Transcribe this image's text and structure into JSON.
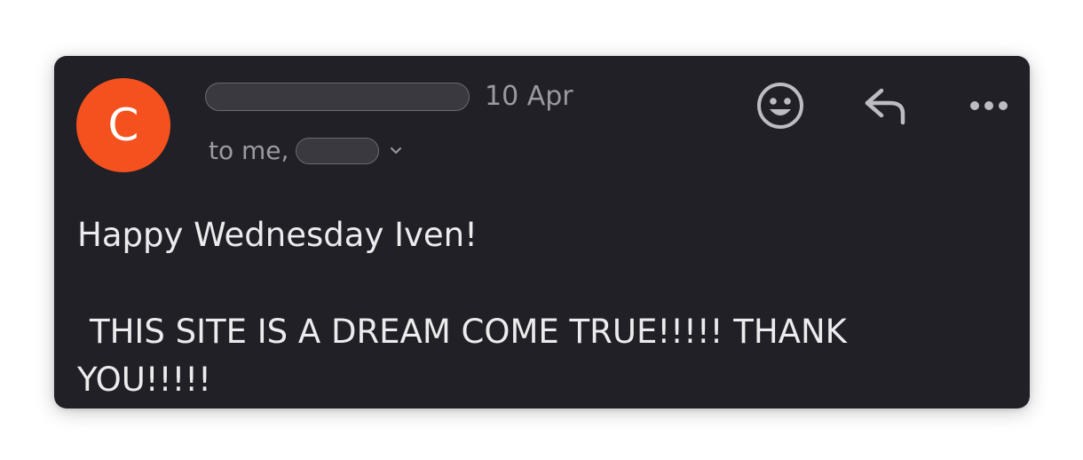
{
  "email": {
    "avatar_letter": "C",
    "avatar_color": "#f4511e",
    "date": "10 Apr",
    "recipients_prefix": "to me,",
    "body_greeting": "Happy Wednesday Iven!",
    "body_line1": "THIS SITE IS A DREAM COME TRUE!!!!! THANK",
    "body_line2": "YOU!!!!!"
  },
  "icons": {
    "emoji": "smiley-face-icon",
    "reply": "reply-arrow-icon",
    "more": "more-horizontal-icon",
    "expand": "chevron-down-icon"
  },
  "colors": {
    "background": "#212026",
    "text_primary": "#ececee",
    "text_secondary": "#9b9aa0"
  }
}
